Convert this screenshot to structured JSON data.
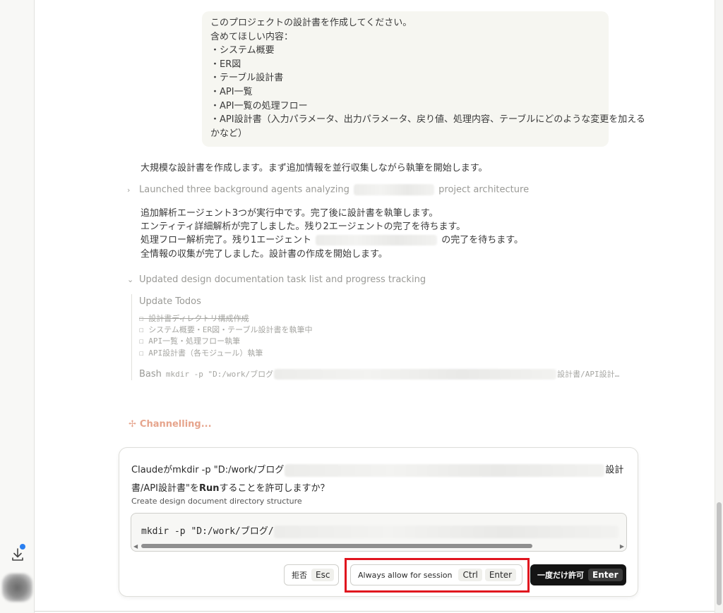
{
  "sidebar": {
    "icons": {
      "download": "download-icon",
      "download_badge_color": "#2a7ff0",
      "avatar": "avatar"
    }
  },
  "conversation": {
    "user_message": {
      "lines": [
        "このプロジェクトの設計書を作成してください。",
        "含めてほしい内容：",
        "・システム概要",
        "・ER図",
        "・テーブル設計書",
        "・API一覧",
        "・API一覧の処理フロー",
        "・API設計書（入力パラメータ、出力パラメータ、戻り値、処理内容、テーブルにどのような変更を加える",
        "かなど）"
      ]
    },
    "assistant_intro": "大規模な設計書を作成します。まず追加情報を並行収集しながら執筆を開始します。",
    "agents_row": {
      "prefix": "Launched three background agents analyzing",
      "suffix": "project architecture"
    },
    "status_lines": {
      "line1": "追加解析エージェント3つが実行中です。完了後に設計書を執筆します。",
      "line2": "エンティティ詳細解析が完了しました。残り2エージェントの完了を待ちます。",
      "line3_prefix": "処理フロー解析完了。残り1エージェント",
      "line3_suffix": "の完了を待ちます。",
      "line4": "全情報の収集が完了しました。設計書の作成を開始します。"
    },
    "todos_row": "Updated design documentation task list and progress tracking",
    "update_todos": {
      "title": "Update Todos",
      "items": [
        "☐ 設計書ディレクトリ構成作成",
        "☐ システム概要・ER図・テーブル設計書を執筆中",
        "☐ API一覧・処理フロー執筆",
        "☐ API設計書（各モジュール）執筆"
      ]
    },
    "bash": {
      "label": "Bash",
      "command_start": "mkdir -p \"D:/work/ブログ",
      "command_end": "設計書/API設計…"
    },
    "channelling": "Channelling..."
  },
  "permission": {
    "question_line1_prefix": "Claudeがmkdir -p \"D:/work/ブログ",
    "question_line1_suffix": "設計",
    "question_line2_a": "書/API設計書\"を",
    "question_line2_bold": "Run",
    "question_line2_b": "することを許可しますか？",
    "subtitle": "Create design document directory structure",
    "command": "mkdir -p \"D:/work/ブログ/",
    "buttons": {
      "deny": {
        "label": "拒否",
        "key": "Esc"
      },
      "always": {
        "label": "Always allow for session",
        "key1": "Ctrl",
        "key2": "Enter"
      },
      "once": {
        "label": "一度だけ許可",
        "key": "Enter"
      }
    },
    "highlight_color": "#e0141e"
  },
  "colors": {
    "accent_channelling": "#e6a48c",
    "primary_button": "#141414"
  }
}
